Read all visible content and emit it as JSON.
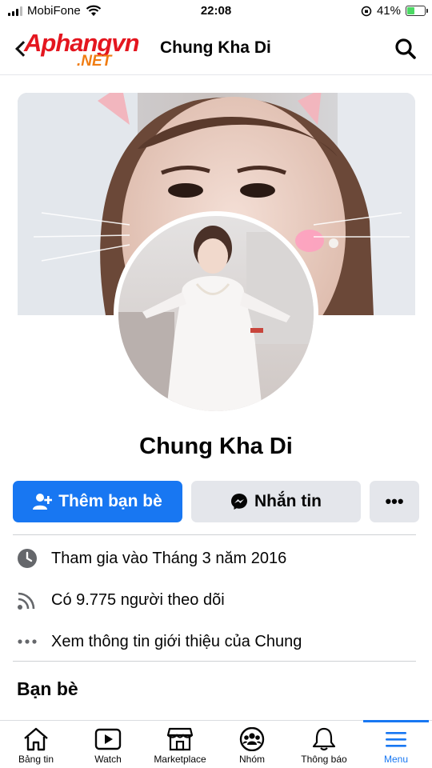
{
  "status_bar": {
    "carrier": "MobiFone",
    "time": "22:08",
    "battery_percent": "41%",
    "battery_level": 0.41
  },
  "header": {
    "logo_main": "Aphangvn",
    "logo_sub": ".NET",
    "title": "Chung Kha Di",
    "search_icon": "search-icon"
  },
  "profile": {
    "name": "Chung Kha Di"
  },
  "actions": {
    "add_friend_label": "Thêm bạn bè",
    "message_label": "Nhắn tin",
    "more_label": "•••"
  },
  "info": [
    {
      "icon": "clock-icon",
      "text": "Tham gia vào Tháng 3 năm 2016"
    },
    {
      "icon": "rss-icon",
      "text": "Có 9.775 người theo dõi"
    },
    {
      "icon": "more-icon",
      "text": "Xem thông tin giới thiệu của Chung"
    }
  ],
  "friends_section": {
    "title": "Bạn bè"
  },
  "bottom_nav": [
    {
      "label": "Bảng tin",
      "icon": "home-icon"
    },
    {
      "label": "Watch",
      "icon": "watch-icon"
    },
    {
      "label": "Marketplace",
      "icon": "marketplace-icon"
    },
    {
      "label": "Nhóm",
      "icon": "groups-icon"
    },
    {
      "label": "Thông báo",
      "icon": "bell-icon"
    },
    {
      "label": "Menu",
      "icon": "menu-icon",
      "active": true
    }
  ],
  "colors": {
    "primary": "#1877f2",
    "button_gray": "#e4e6eb",
    "logo_red": "#e4161f",
    "logo_orange": "#f07c12"
  }
}
